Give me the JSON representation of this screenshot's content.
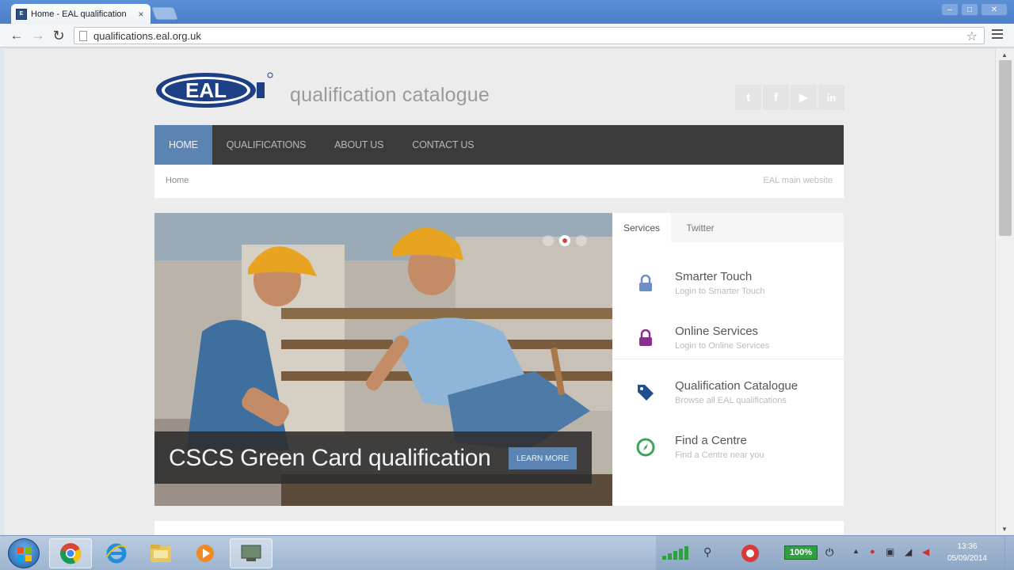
{
  "browser": {
    "tab_title": "Home - EAL qualification",
    "tab_close": "×",
    "url": "qualifications.eal.org.uk",
    "window_controls": [
      "–",
      "□",
      "✕"
    ]
  },
  "site": {
    "logo_text": "EAL",
    "title": "qualification catalogue",
    "social": [
      "twitter-icon",
      "facebook-icon",
      "youtube-icon",
      "linkedin-icon"
    ]
  },
  "nav": {
    "items": [
      {
        "label": "HOME",
        "active": true
      },
      {
        "label": "QUALIFICATIONS",
        "active": false
      },
      {
        "label": "ABOUT US",
        "active": false
      },
      {
        "label": "CONTACT US",
        "active": false
      }
    ]
  },
  "breadcrumb": {
    "current": "Home",
    "main_site_link": "EAL main website"
  },
  "hero": {
    "caption": "CSCS Green Card qualification",
    "button_label": "LEARN MORE",
    "slides": 3,
    "active_slide": 2
  },
  "services": {
    "tabs": [
      {
        "label": "Services",
        "active": true
      },
      {
        "label": "Twitter",
        "active": false
      }
    ],
    "items": [
      {
        "title": "Smarter Touch",
        "subtitle": "Login to Smarter Touch",
        "icon": "lock-icon",
        "color": "#6b8fc4"
      },
      {
        "title": "Online Services",
        "subtitle": "Login to Online Services",
        "icon": "lock-icon",
        "color": "#8b2f8f"
      },
      {
        "title": "Qualification Catalogue",
        "subtitle": "Browse all EAL qualifications",
        "icon": "tag-icon",
        "color": "#1f4f8f"
      },
      {
        "title": "Find a Centre",
        "subtitle": "Find a Centre near you",
        "icon": "compass-icon",
        "color": "#3aa655"
      }
    ]
  },
  "taskbar": {
    "battery": "100%",
    "time": "13:36",
    "date": "05/09/2014"
  },
  "colors": {
    "nav_bg": "#3b3b3b",
    "nav_active": "#5b84b3",
    "accent": "#5b84b3",
    "eal_blue": "#1d3f86"
  }
}
